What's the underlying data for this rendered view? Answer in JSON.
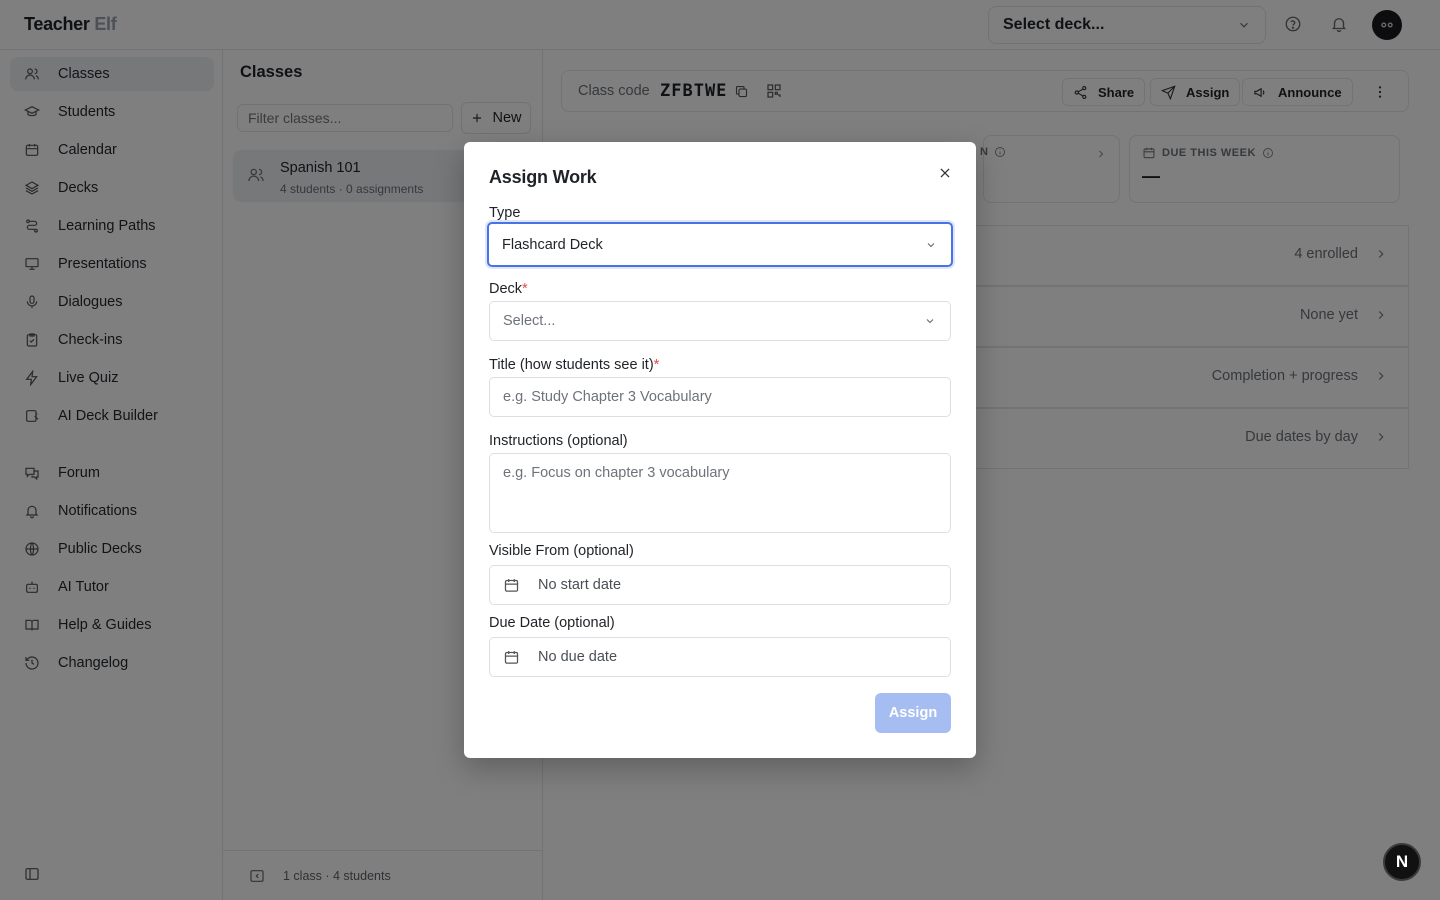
{
  "app": {
    "logo_main": "Teacher",
    "logo_accent": "Elf"
  },
  "topbar": {
    "deck_select_label": "Select deck...",
    "icons": [
      "help-circle-icon",
      "bell-icon",
      "avatar"
    ]
  },
  "sidebar": {
    "items": [
      {
        "label": "Classes",
        "icon": "users-icon",
        "active": true
      },
      {
        "label": "Students",
        "icon": "graduation-cap-icon"
      },
      {
        "label": "Calendar",
        "icon": "calendar-icon"
      },
      {
        "label": "Decks",
        "icon": "layers-icon"
      },
      {
        "label": "Learning Paths",
        "icon": "route-icon"
      },
      {
        "label": "Presentations",
        "icon": "presentation-icon"
      },
      {
        "label": "Dialogues",
        "icon": "mic-icon"
      },
      {
        "label": "Check-ins",
        "icon": "clipboard-check-icon"
      },
      {
        "label": "Live Quiz",
        "icon": "zap-icon"
      },
      {
        "label": "AI Deck Builder",
        "icon": "wand-icon"
      },
      {
        "label": "Forum",
        "icon": "messages-icon"
      },
      {
        "label": "Notifications",
        "icon": "bell-icon"
      },
      {
        "label": "Public Decks",
        "icon": "globe-icon"
      },
      {
        "label": "AI Tutor",
        "icon": "bot-icon"
      },
      {
        "label": "Help & Guides",
        "icon": "book-open-icon"
      },
      {
        "label": "Changelog",
        "icon": "history-icon"
      }
    ]
  },
  "classes_panel": {
    "title": "Classes",
    "filter_placeholder": "Filter classes...",
    "new_label": "New",
    "classes": [
      {
        "name": "Spanish 101",
        "meta": "4 students · 0 assignments"
      }
    ],
    "footer": "1 class · 4 students"
  },
  "main": {
    "code_label": "Class code",
    "code_value": "ZFBTWE",
    "actions": {
      "share": "Share",
      "assign": "Assign",
      "announce": "Announce"
    },
    "stats": [
      {
        "label": "N",
        "value": ""
      },
      {
        "label": "DUE THIS WEEK",
        "value": "—"
      }
    ],
    "rows": [
      {
        "right": "4 enrolled"
      },
      {
        "right": "None yet"
      },
      {
        "right": "Completion + progress"
      },
      {
        "right": "Due dates by day"
      }
    ]
  },
  "modal": {
    "title": "Assign Work",
    "type_label": "Type",
    "type_value": "Flashcard Deck",
    "deck_label": "Deck",
    "deck_placeholder": "Select...",
    "title_label": "Title (how students see it)",
    "title_placeholder": "e.g. Study Chapter 3 Vocabulary",
    "instructions_label": "Instructions (optional)",
    "instructions_placeholder": "e.g. Focus on chapter 3 vocabulary",
    "visible_from_label": "Visible From (optional)",
    "visible_from_value": "No start date",
    "due_date_label": "Due Date (optional)",
    "due_date_value": "No due date",
    "required_mark": "*",
    "assign_label": "Assign"
  },
  "badge": "N"
}
